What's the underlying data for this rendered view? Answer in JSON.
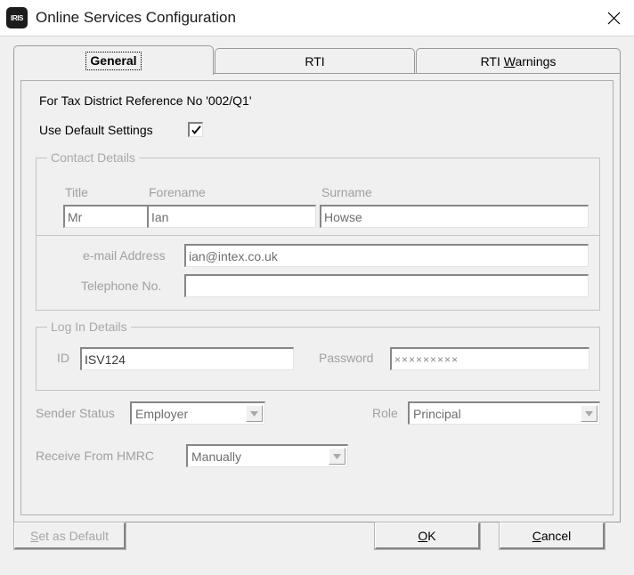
{
  "window": {
    "title": "Online Services Configuration",
    "app_icon": "iris-logo-icon",
    "app_icon_text": "IRIS",
    "close_icon": "close-icon"
  },
  "tabs": [
    {
      "label": "General",
      "selected": true
    },
    {
      "label": "RTI",
      "selected": false
    },
    {
      "label": "RTI Warnings",
      "accel": "W",
      "selected": false
    }
  ],
  "general": {
    "heading": "For Tax District Reference No '002/Q1'",
    "use_default": {
      "label": "Use Default Settings",
      "checked": true,
      "check_icon": "checkmark-icon"
    },
    "contact_details": {
      "group_label": "Contact Details",
      "title": {
        "label": "Title",
        "value": "Mr"
      },
      "forename": {
        "label": "Forename",
        "value": "Ian"
      },
      "surname": {
        "label": "Surname",
        "value": "Howse"
      },
      "email": {
        "label": "e-mail Address",
        "value": "ian@intex.co.uk"
      },
      "telephone": {
        "label": "Telephone No.",
        "value": ""
      }
    },
    "login_details": {
      "group_label": "Log In Details",
      "id": {
        "label": "ID",
        "value": "ISV124"
      },
      "password": {
        "label": "Password",
        "value": "×××××××××"
      }
    },
    "sender_status": {
      "label": "Sender Status",
      "value": "Employer",
      "arrow_icon": "chevron-down-icon"
    },
    "role": {
      "label": "Role",
      "value": "Principal",
      "arrow_icon": "chevron-down-icon"
    },
    "receive_from_hmrc": {
      "label": "Receive From HMRC",
      "value": "Manually",
      "arrow_icon": "chevron-down-icon"
    }
  },
  "footer": {
    "set_as_default": {
      "label": "Set as Default",
      "accel": "S",
      "disabled": true
    },
    "ok": {
      "label": "OK",
      "accel": "O"
    },
    "cancel": {
      "label": "Cancel",
      "accel": "C"
    }
  },
  "colors": {
    "window_bg": "#f0f0f0",
    "titlebar_bg": "#ffffff",
    "field_bg": "#ffffff",
    "disabled_text": "#a0a0a0",
    "border": "#9a9a9a"
  }
}
